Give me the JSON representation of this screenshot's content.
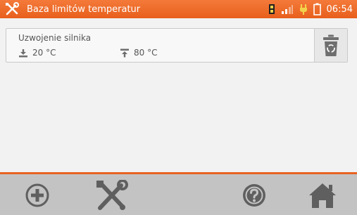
{
  "header": {
    "title": "Baza limitów temperatur",
    "time": "06:54",
    "icons": [
      "tools-icon",
      "memory-card-icon",
      "signal-icon",
      "plug-icon",
      "battery-icon"
    ]
  },
  "record": {
    "name": "Uzwojenie silnika",
    "min_temp": "20 °C",
    "max_temp": "80 °C",
    "icons": [
      "min-temp-icon",
      "max-temp-icon",
      "trash-icon"
    ]
  },
  "footer": {
    "buttons": [
      "add-icon",
      "tools-icon",
      "help-icon",
      "home-icon"
    ]
  },
  "colors": {
    "accent": "#e8621f",
    "bottom_bar": "#c3c3c3",
    "icon_gray": "#6e6e6e"
  }
}
